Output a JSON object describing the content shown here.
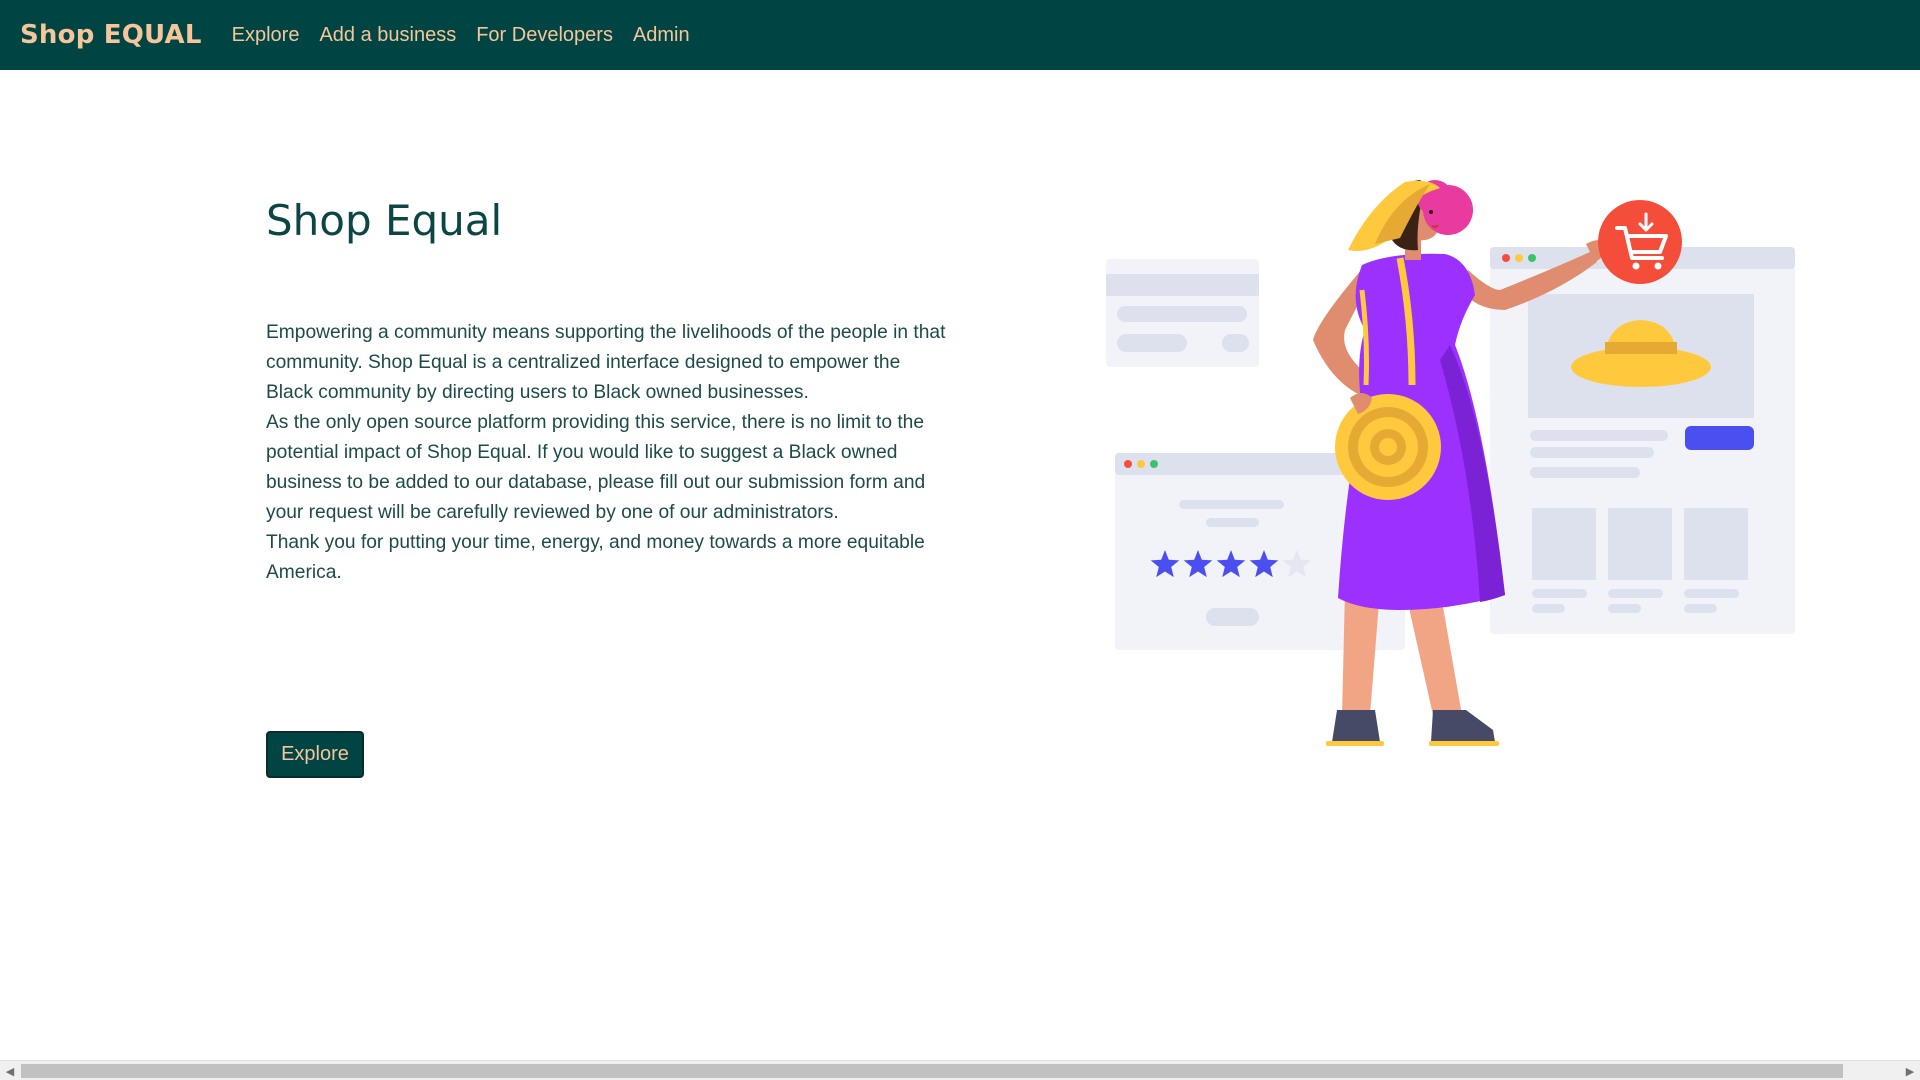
{
  "nav": {
    "brand": "Shop EQUAL",
    "links": [
      "Explore",
      "Add a business",
      "For Developers",
      "Admin"
    ]
  },
  "hero": {
    "title": "Shop Equal",
    "paragraphs": [
      "Empowering a community means supporting the livelihoods of the people in that community. Shop Equal is a centralized interface designed to empower the Black community by directing users to Black owned businesses.",
      "As the only open source platform providing this service, there is no limit to the potential impact of Shop Equal. If you would like to suggest a Black owned business to be added to our database, please fill out our submission form and your request will be carefully reviewed by one of our administrators.",
      "Thank you for putting your time, energy, and money towards a more equitable America."
    ],
    "button_label": "Explore"
  },
  "illustration": {
    "rating_stars_filled": 4,
    "rating_stars_total": 5,
    "icon": "shopping-cart-icon"
  },
  "colors": {
    "nav_bg": "#004544",
    "nav_text": "#f6c59a",
    "title": "#0d4444",
    "accent_purple": "#9b30ff",
    "cart_red": "#f44e3b",
    "hat_yellow": "#ffc83d",
    "star_blue": "#4b4ff0"
  }
}
